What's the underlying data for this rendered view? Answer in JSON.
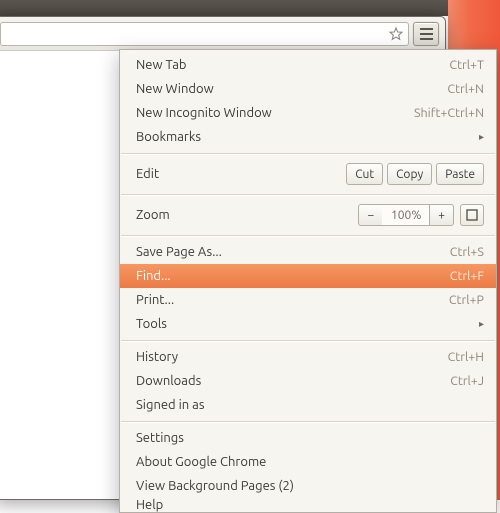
{
  "toolbar": {
    "bookmark_star": "star-outline-icon",
    "menu_button": "hamburger-icon"
  },
  "menu": {
    "new_tab": {
      "label": "New Tab",
      "shortcut": "Ctrl+T"
    },
    "new_window": {
      "label": "New Window",
      "shortcut": "Ctrl+N"
    },
    "new_incognito": {
      "label": "New Incognito Window",
      "shortcut": "Shift+Ctrl+N"
    },
    "bookmarks": {
      "label": "Bookmarks"
    },
    "edit": {
      "label": "Edit",
      "cut": "Cut",
      "copy": "Copy",
      "paste": "Paste"
    },
    "zoom": {
      "label": "Zoom",
      "minus": "−",
      "pct": "100%",
      "plus": "+"
    },
    "save_as": {
      "label": "Save Page As...",
      "shortcut": "Ctrl+S"
    },
    "find": {
      "label": "Find...",
      "shortcut": "Ctrl+F"
    },
    "print": {
      "label": "Print...",
      "shortcut": "Ctrl+P"
    },
    "tools": {
      "label": "Tools"
    },
    "history": {
      "label": "History",
      "shortcut": "Ctrl+H"
    },
    "downloads": {
      "label": "Downloads",
      "shortcut": "Ctrl+J"
    },
    "signed_in": {
      "label": "Signed in as"
    },
    "settings": {
      "label": "Settings"
    },
    "about": {
      "label": "About Google Chrome"
    },
    "bg_pages": {
      "label": "View Background Pages (2)"
    },
    "help": {
      "label": "Help"
    }
  }
}
